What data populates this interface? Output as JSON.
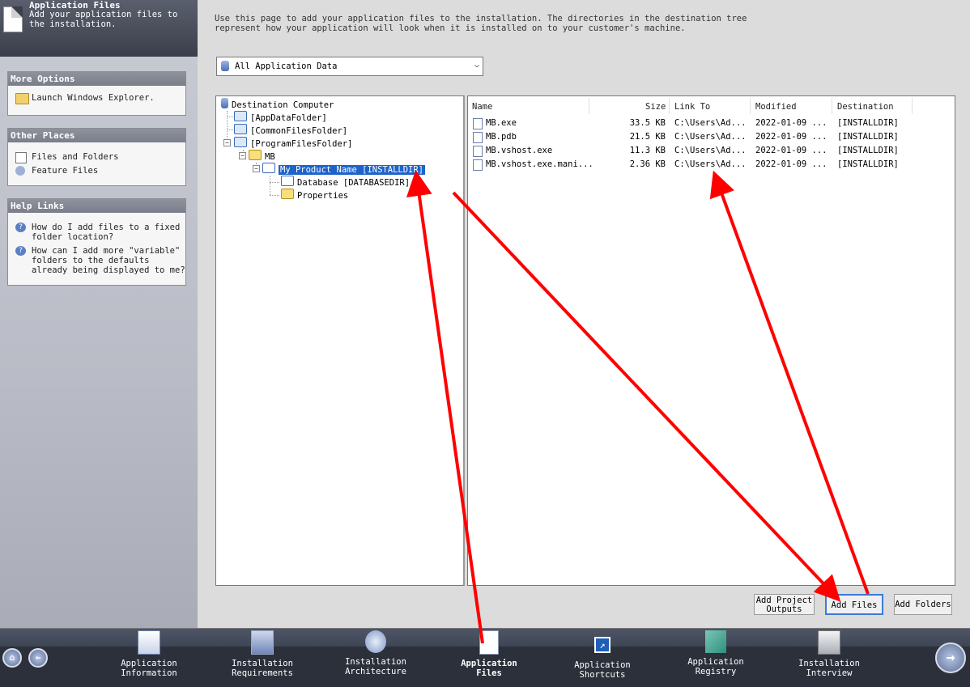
{
  "header": {
    "title": "Application Files",
    "subtitle": "Add your application files to the installation."
  },
  "more_options": {
    "title": "More Options",
    "items": [
      "Launch Windows Explorer."
    ]
  },
  "other_places": {
    "title": "Other Places",
    "items": [
      "Files and Folders",
      "Feature Files"
    ]
  },
  "help_links": {
    "title": "Help Links",
    "items": [
      "How do I add files to a fixed folder location?",
      "How can I add more \"variable\" folders to the defaults already being displayed to me?"
    ]
  },
  "description": "Use this page to add your application files to the installation. The directories in the destination tree\nrepresent how your application will look when it is installed on to your customer's machine.",
  "filter": {
    "value": "All Application Data"
  },
  "tree": {
    "root": "Destination Computer",
    "nodes": [
      "[AppDataFolder]",
      "[CommonFilesFolder]",
      "[ProgramFilesFolder]",
      "MB",
      "My Product Name [INSTALLDIR]",
      "Database [DATABASEDIR]",
      "Properties"
    ]
  },
  "files": {
    "columns": [
      "Name",
      "Size",
      "Link To",
      "Modified",
      "Destination"
    ],
    "rows": [
      [
        "MB.exe",
        "33.5 KB",
        "C:\\Users\\Ad...",
        "2022-01-09 ...",
        "[INSTALLDIR]"
      ],
      [
        "MB.pdb",
        "21.5 KB",
        "C:\\Users\\Ad...",
        "2022-01-09 ...",
        "[INSTALLDIR]"
      ],
      [
        "MB.vshost.exe",
        "11.3 KB",
        "C:\\Users\\Ad...",
        "2022-01-09 ...",
        "[INSTALLDIR]"
      ],
      [
        "MB.vshost.exe.mani...",
        "2.36 KB",
        "C:\\Users\\Ad...",
        "2022-01-09 ...",
        "[INSTALLDIR]"
      ]
    ]
  },
  "buttons": {
    "add_project_outputs_1": "Add Project",
    "add_project_outputs_2": "Outputs",
    "add_files": "Add Files",
    "add_folders": "Add Folders"
  },
  "bottom_nav": [
    {
      "l1": "Application",
      "l2": "Information"
    },
    {
      "l1": "Installation",
      "l2": "Requirements"
    },
    {
      "l1": "Installation",
      "l2": "Architecture"
    },
    {
      "l1": "Application",
      "l2": "Files"
    },
    {
      "l1": "Application",
      "l2": "Shortcuts"
    },
    {
      "l1": "Application",
      "l2": "Registry"
    },
    {
      "l1": "Installation",
      "l2": "Interview"
    }
  ],
  "colors": {
    "arrow": "#ff0000",
    "selection": "#1e63c8"
  }
}
